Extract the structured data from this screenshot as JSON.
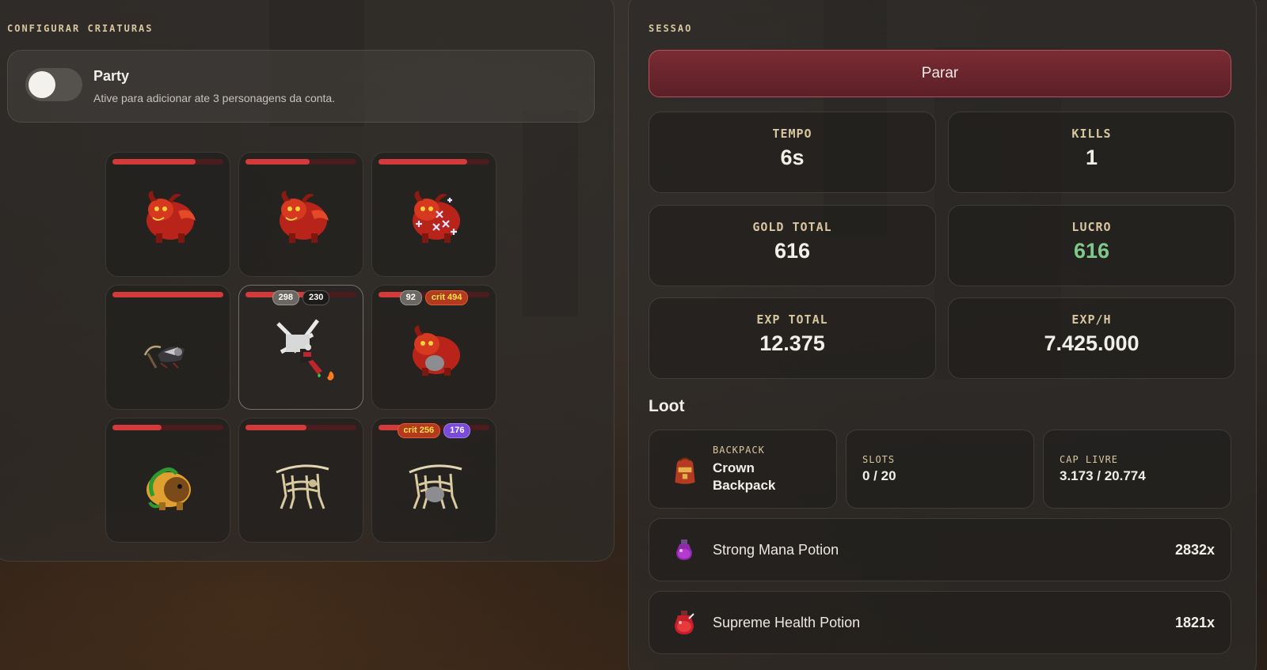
{
  "left": {
    "title": "CONFIGURAR CRIATURAS",
    "party": {
      "label": "Party",
      "description": "Ative para adicionar ate 3 personagens da conta.",
      "enabled": false
    },
    "creatures": [
      {
        "name": "demon",
        "hp": 0.75,
        "badges": []
      },
      {
        "name": "demon",
        "hp": 0.58,
        "badges": []
      },
      {
        "name": "demon-sparkles",
        "hp": 0.8,
        "badges": []
      },
      {
        "name": "reaper",
        "hp": 1.0,
        "badges": []
      },
      {
        "name": "player-character",
        "hp": 0.72,
        "badges": [
          {
            "text": "298",
            "style": "gray"
          },
          {
            "text": "230",
            "style": "dark"
          }
        ]
      },
      {
        "name": "demon-stone",
        "hp": 0.38,
        "badges": [
          {
            "text": "92",
            "style": "gray"
          },
          {
            "text": "crit 494",
            "style": "crit"
          }
        ]
      },
      {
        "name": "green-beast",
        "hp": 0.44,
        "badges": []
      },
      {
        "name": "bone-beast",
        "hp": 0.55,
        "badges": []
      },
      {
        "name": "bone-beast-stone",
        "hp": 0.3,
        "badges": [
          {
            "text": "crit 256",
            "style": "crit"
          },
          {
            "text": "176",
            "style": "purple"
          }
        ]
      }
    ]
  },
  "right": {
    "title": "SESSAO",
    "stop_label": "Parar",
    "stats": [
      {
        "label": "TEMPO",
        "value": "6s",
        "highlight": false
      },
      {
        "label": "KILLS",
        "value": "1",
        "highlight": false
      },
      {
        "label": "GOLD TOTAL",
        "value": "616",
        "highlight": false
      },
      {
        "label": "LUCRO",
        "value": "616",
        "highlight": true
      },
      {
        "label": "EXP TOTAL",
        "value": "12.375",
        "highlight": false
      },
      {
        "label": "EXP/H",
        "value": "7.425.000",
        "highlight": false
      }
    ],
    "loot_title": "Loot",
    "backpack": {
      "label": "BACKPACK",
      "name_line1": "Crown",
      "name_line2": "Backpack"
    },
    "slots": {
      "label": "SLOTS",
      "value": "0 / 20"
    },
    "cap": {
      "label": "CAP LIVRE",
      "value": "3.173 / 20.774"
    },
    "loot_items": [
      {
        "name": "Strong Mana Potion",
        "count": "2832x",
        "icon": "mana-potion-icon"
      },
      {
        "name": "Supreme Health Potion",
        "count": "1821x",
        "icon": "health-potion-icon"
      }
    ]
  },
  "colors": {
    "accent_label": "#d8c6a0",
    "hp_bar": "#d33a3a",
    "stop_button": "#6b2530",
    "profit": "#7fc88a"
  }
}
